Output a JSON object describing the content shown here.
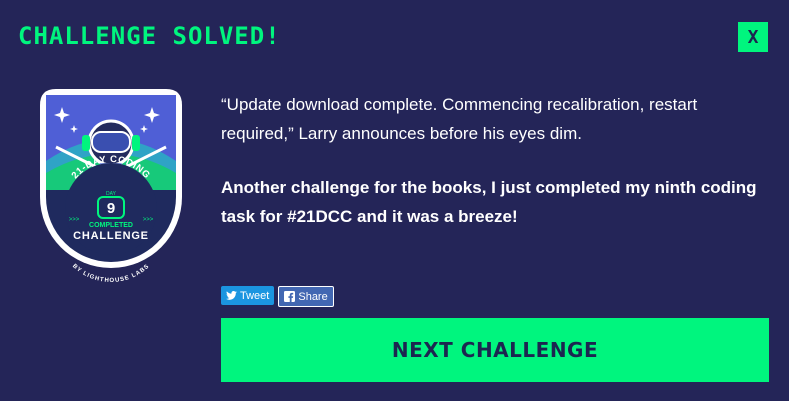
{
  "header": {
    "title": "CHALLENGE SOLVED!",
    "close_label": "X"
  },
  "badge": {
    "top_text": "21-DAY CODING",
    "day_label": "DAY",
    "day_number": "9",
    "completed_label": "COMPLETED",
    "challenge_label": "CHALLENGE",
    "byline": "BY LIGHTHOUSE LABS",
    "arrows": ">>>"
  },
  "body": {
    "paragraph1": "“Update download complete. Commencing recalibration, restart required,” Larry announces before his eyes dim.",
    "paragraph2": "Another challenge for the books, I just completed my ninth coding task for #21DCC and it was a breeze!"
  },
  "share": {
    "tweet_label": "Tweet",
    "facebook_label": "Share"
  },
  "actions": {
    "next_label": "NEXT CHALLENGE"
  },
  "colors": {
    "background": "#242558",
    "accent": "#00f57e",
    "button_text": "#1c2650"
  }
}
